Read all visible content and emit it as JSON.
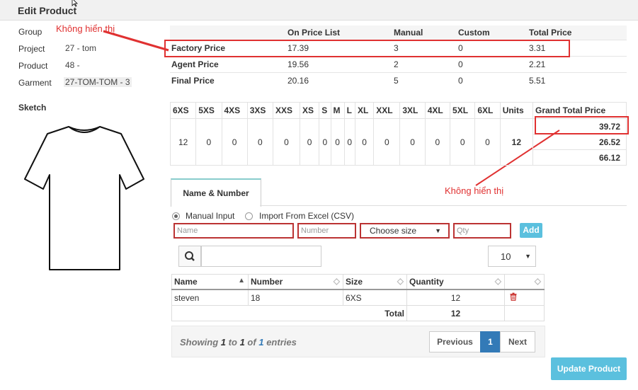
{
  "dialog": {
    "title": "Edit Product"
  },
  "info": {
    "group_label": "Group",
    "project_label": "Project",
    "project_value": "27 - tom",
    "product_label": "Product",
    "product_value": "48 -",
    "garment_label": "Garment",
    "garment_value": "27-TOM-TOM - 3",
    "sketch_label": "Sketch"
  },
  "annotations": {
    "note1": "Không hiển thị",
    "note2": "Không hiển thị"
  },
  "prices": {
    "headers": [
      "On Price List",
      "Manual",
      "Custom",
      "Total Price"
    ],
    "rows": [
      {
        "label": "Factory Price",
        "price_list": "17.39",
        "manual": "3",
        "custom": "0",
        "total": "3.31"
      },
      {
        "label": "Agent Price",
        "price_list": "19.56",
        "manual": "2",
        "custom": "0",
        "total": "2.21"
      },
      {
        "label": "Final Price",
        "price_list": "20.16",
        "manual": "5",
        "custom": "0",
        "total": "5.51"
      }
    ]
  },
  "sizes": {
    "headers": [
      "6XS",
      "5XS",
      "4XS",
      "3XS",
      "XXS",
      "XS",
      "S",
      "M",
      "L",
      "XL",
      "XXL",
      "3XL",
      "4XL",
      "5XL",
      "6XL"
    ],
    "values": [
      "12",
      "0",
      "0",
      "0",
      "0",
      "0",
      "0",
      "0",
      "0",
      "0",
      "0",
      "0",
      "0",
      "0",
      "0"
    ],
    "units_label": "Units",
    "units_value": "12",
    "grand_total_label": "Grand Total Price",
    "grand_totals": [
      "39.72",
      "26.52",
      "66.12"
    ]
  },
  "tabs": {
    "name_number": "Name & Number"
  },
  "form": {
    "manual_input_label": "Manual Input",
    "import_label": "Import From Excel (CSV)",
    "name_placeholder": "Name",
    "number_placeholder": "Number",
    "size_select": "Choose size",
    "qty_placeholder": "Qty",
    "add_label": "Add"
  },
  "list": {
    "per_page": "10",
    "columns": [
      "Name",
      "Number",
      "Size",
      "Quantity"
    ],
    "rows": [
      {
        "name": "steven",
        "number": "18",
        "size": "6XS",
        "quantity": "12"
      }
    ],
    "total_label": "Total",
    "total_value": "12"
  },
  "pagination": {
    "showing_prefix": "Showing",
    "from": "1",
    "to_word": "to",
    "to": "1",
    "of_word": "of",
    "total": "1",
    "suffix": "entries",
    "previous": "Previous",
    "current": "1",
    "next": "Next"
  },
  "update_label": "Update Product"
}
